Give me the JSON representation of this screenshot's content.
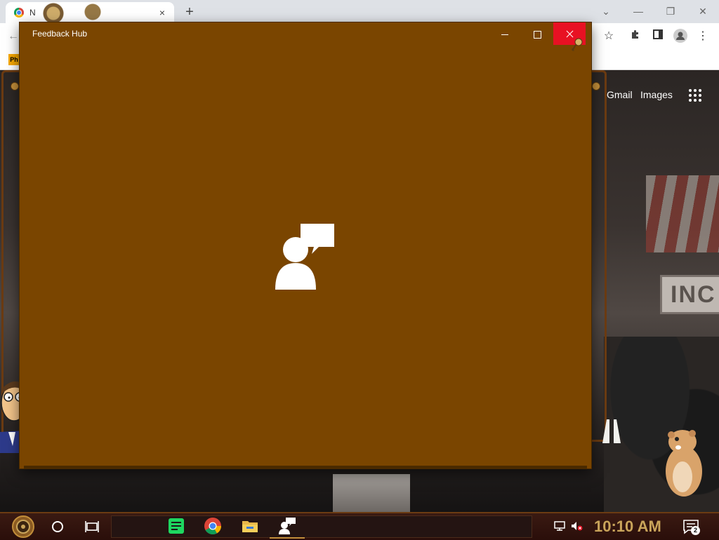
{
  "browser": {
    "tab_title": "N",
    "new_tab": "+",
    "tab_close": "×",
    "bookmark_label": "Ph",
    "google_links": {
      "gmail": "Gmail",
      "images": "Images"
    },
    "page_sign": "INC"
  },
  "feedback_hub": {
    "title": "Feedback Hub",
    "background": "#7a4500",
    "close_hover_color": "#e81123"
  },
  "taskbar": {
    "clock": "10:10 AM",
    "notification_count": "2",
    "apps": [
      "notes-app",
      "chrome",
      "file-explorer",
      "feedback-hub"
    ]
  }
}
